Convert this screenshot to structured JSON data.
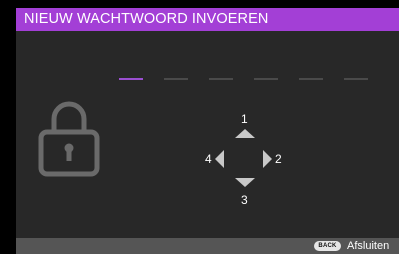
{
  "dialog": {
    "title": "NIEUW WACHTWOORD INVOEREN"
  },
  "password": {
    "digit_count": 6,
    "entered_count": 0,
    "active_index": 0
  },
  "navigation": {
    "up_label": "1",
    "right_label": "2",
    "down_label": "3",
    "left_label": "4"
  },
  "footer": {
    "back_key_label": "BACK",
    "back_action_label": "Afsluiten"
  },
  "colors": {
    "title_bar": "#a33fd6",
    "active_slot": "#9b4fd1",
    "inactive_slot": "#4a4a4a",
    "background": "#282828",
    "footer": "#555555"
  },
  "icons": {
    "lock": "lock-icon",
    "up": "triangle-up-icon",
    "down": "triangle-down-icon",
    "left": "triangle-left-icon",
    "right": "triangle-right-icon"
  }
}
